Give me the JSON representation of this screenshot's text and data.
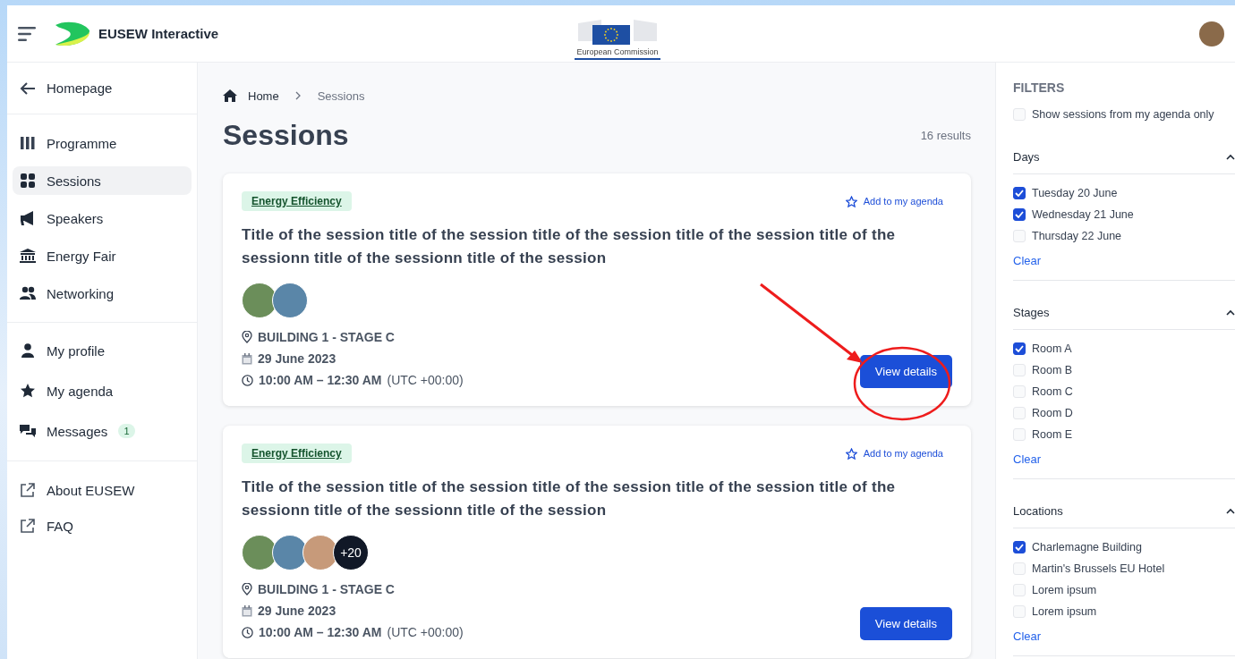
{
  "header": {
    "brand": "EUSEW Interactive",
    "logo_caption": "European Commission"
  },
  "sidebar": {
    "back": "Homepage",
    "groups": [
      [
        {
          "label": "Programme",
          "selected": false
        },
        {
          "label": "Sessions",
          "selected": true
        },
        {
          "label": "Speakers",
          "selected": false
        },
        {
          "label": "Energy Fair",
          "selected": false
        },
        {
          "label": "Networking",
          "selected": false
        }
      ],
      [
        {
          "label": "My profile",
          "selected": false
        },
        {
          "label": "My agenda",
          "selected": false
        },
        {
          "label": "Messages",
          "selected": false,
          "badge": "1"
        }
      ],
      [
        {
          "label": "About EUSEW",
          "selected": false
        },
        {
          "label": "FAQ",
          "selected": false
        }
      ]
    ]
  },
  "breadcrumb": [
    "Home",
    "Sessions"
  ],
  "page_title": "Sessions",
  "results": "16 results",
  "sessions": [
    {
      "tag": "Energy Efficiency",
      "add_label": "Add to my agenda",
      "title": "Title of the session title of the session title of the session title of the session title of the sessionn title of the sessionn title of the session",
      "speakers": [
        {
          "kind": "photo"
        },
        {
          "kind": "photo"
        }
      ],
      "location": "BUILDING 1 - STAGE C",
      "date": "29 June 2023",
      "time": "10:00 AM – 12:30 AM",
      "timezone": "(UTC +00:00)",
      "button": "View details"
    },
    {
      "tag": "Energy Efficiency",
      "add_label": "Add to my agenda",
      "title": "Title of the session title of the session title of the session title of the session title of the sessionn title of the sessionn title of the session",
      "speakers": [
        {
          "kind": "photo"
        },
        {
          "kind": "photo"
        },
        {
          "kind": "photo"
        },
        {
          "kind": "more",
          "label": "+20"
        }
      ],
      "location": "BUILDING 1 - STAGE C",
      "date": "29 June 2023",
      "time": "10:00 AM – 12:30 AM",
      "timezone": "(UTC +00:00)",
      "button": "View details"
    }
  ],
  "filters": {
    "title": "FILTERS",
    "agenda_only": {
      "label": "Show sessions from my agenda only",
      "checked": false
    },
    "groups": [
      {
        "title": "Days",
        "expanded": true,
        "clear": "Clear",
        "options": [
          {
            "label": "Tuesday 20 June",
            "checked": true
          },
          {
            "label": "Wednesday 21 June",
            "checked": true
          },
          {
            "label": "Thursday 22 June",
            "checked": false
          }
        ]
      },
      {
        "title": "Stages",
        "expanded": true,
        "clear": "Clear",
        "options": [
          {
            "label": "Room A",
            "checked": true
          },
          {
            "label": "Room B",
            "checked": false
          },
          {
            "label": "Room C",
            "checked": false
          },
          {
            "label": "Room D",
            "checked": false
          },
          {
            "label": "Room E",
            "checked": false
          }
        ]
      },
      {
        "title": "Locations",
        "expanded": true,
        "clear": "Clear",
        "options": [
          {
            "label": "Charlemagne Building",
            "checked": true
          },
          {
            "label": "Martin's Brussels EU Hotel",
            "checked": false
          },
          {
            "label": "Lorem ipsum",
            "checked": false
          },
          {
            "label": "Lorem ipsum",
            "checked": false
          }
        ]
      }
    ]
  }
}
